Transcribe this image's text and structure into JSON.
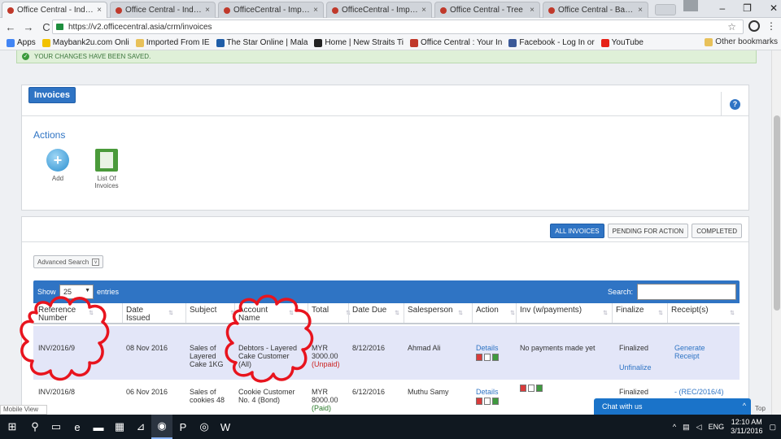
{
  "browser": {
    "tabs": [
      {
        "title": "Office Central - Index",
        "active": true
      },
      {
        "title": "Office Central - Index",
        "active": false
      },
      {
        "title": "OfficeCentral - Import In",
        "active": false
      },
      {
        "title": "OfficeCentral - Import In",
        "active": false
      },
      {
        "title": "Office Central - Tree",
        "active": false
      },
      {
        "title": "Office Central - Balance",
        "active": false
      }
    ],
    "tab_close": "×",
    "window_controls": {
      "minimize": "–",
      "maximize": "❐",
      "close": "✕"
    },
    "url": "https://v2.officecentral.asia/crm/invoices",
    "nav": {
      "back": "←",
      "forward": "→",
      "reload": "C"
    },
    "star": "☆",
    "menu": "⋮",
    "bookmarks": [
      {
        "label": "Apps",
        "icon": "apps-grid-icon",
        "color": "#4285f4"
      },
      {
        "label": "Maybank2u.com Onli",
        "icon": "maybank-icon",
        "color": "#f2c200"
      },
      {
        "label": "Imported From IE",
        "icon": "folder-icon",
        "color": "#e8c15a"
      },
      {
        "label": "The Star Online | Mala",
        "icon": "star-online-icon",
        "color": "#1f5ea8"
      },
      {
        "label": "Home | New Straits Ti",
        "icon": "nst-icon",
        "color": "#222222"
      },
      {
        "label": "Office Central : Your In",
        "icon": "officecentral-icon",
        "color": "#c0392b"
      },
      {
        "label": "Facebook - Log In or",
        "icon": "facebook-icon",
        "color": "#3b5998"
      },
      {
        "label": "YouTube",
        "icon": "youtube-icon",
        "color": "#e62117"
      }
    ],
    "other_bookmarks": "Other bookmarks"
  },
  "flash": {
    "message": "YOUR CHANGES HAVE BEEN SAVED."
  },
  "invoices_panel": {
    "title": "Invoices",
    "help": "?",
    "actions_label": "Actions",
    "actions": [
      {
        "label": "Add",
        "icon": "add-icon"
      },
      {
        "label": "List Of Invoices",
        "icon": "list-invoices-icon"
      }
    ]
  },
  "list_panel": {
    "filter_tabs": [
      {
        "label": "ALL INVOICES",
        "active": true
      },
      {
        "label": "PENDING FOR ACTION",
        "active": false
      },
      {
        "label": "COMPLETED",
        "active": false
      }
    ],
    "advanced_search": "Advanced Search",
    "show_label": "Show",
    "entries_value": "25",
    "entries_label": "entries",
    "search_label": "Search:",
    "columns": [
      "Reference Number",
      "Date Issued",
      "Subject",
      "Account Name",
      "Total",
      "Date Due",
      "Salesperson",
      "Action",
      "Inv (w/payments)",
      "Finalize",
      "Receipt(s)"
    ],
    "rows": [
      {
        "ref": "INV/2016/9",
        "date_issued": "08 Nov 2016",
        "subject": "Sales of Layered Cake 1KG",
        "account": "Debtors - Layered Cake Customer (All)",
        "total": "MYR 3000.00",
        "status": "(Unpaid)",
        "date_due": "8/12/2016",
        "salesperson": "Ahmad Ali",
        "action": "Details",
        "inv_payments": "No payments made yet",
        "finalize": "Finalized",
        "unfinalize": "Unfinalize",
        "receipt": "Generate Receipt"
      },
      {
        "ref": "INV/2016/8",
        "date_issued": "06 Nov 2016",
        "subject": "Sales of cookies 48",
        "account": "Cookie Customer No. 4 (Bond)",
        "total": "MYR 8000.00",
        "status": "(Paid)",
        "date_due": "6/12/2016",
        "salesperson": "Muthu Samy",
        "action": "Details",
        "inv_payments": "",
        "finalize": "Finalized",
        "unfinalize": "",
        "receipt": "- (REC/2016/4) "
      }
    ]
  },
  "overlays": {
    "mobile_view": "Mobile View",
    "chat": "Chat with us",
    "chat_toggle": "^",
    "top_link": "Top"
  },
  "taskbar": {
    "language": "ENG",
    "time": "12:10 AM",
    "date": "3/11/2016",
    "tray_up": "^"
  },
  "annotation_color": "#e8141e",
  "accent_color": "#2f74c4"
}
